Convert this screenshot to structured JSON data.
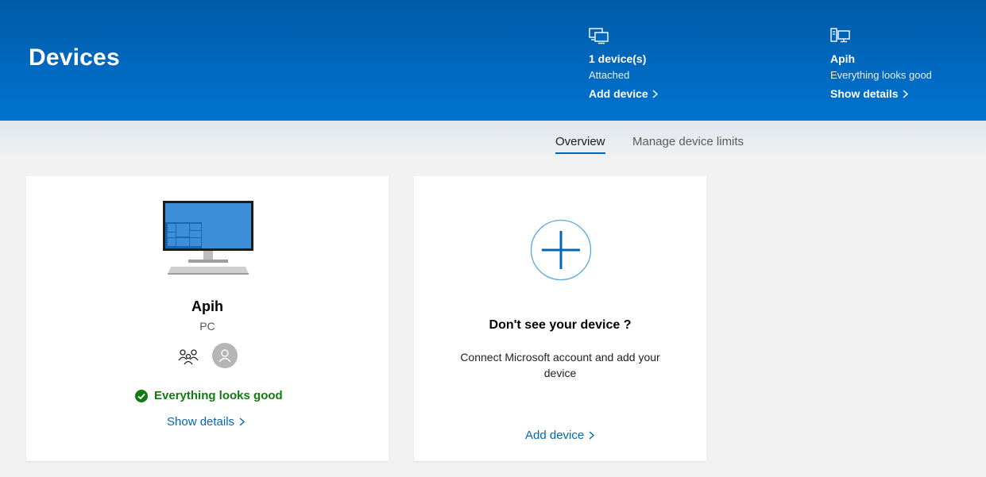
{
  "header": {
    "title": "Devices",
    "stats": {
      "devices": {
        "icon": "devices-icon",
        "headline": "1 device(s)",
        "sub": "Attached",
        "action": "Add device"
      },
      "pc": {
        "icon": "pc-icon",
        "headline": "Apih",
        "sub": "Everything looks good",
        "action": "Show details"
      }
    }
  },
  "tabs": [
    {
      "label": "Overview",
      "active": true
    },
    {
      "label": "Manage device limits",
      "active": false
    }
  ],
  "device_card": {
    "image": "monitor-icon",
    "name": "Apih",
    "type": "PC",
    "family_icon": "family-icon",
    "avatar_icon": "avatar-icon",
    "status": "Everything looks good",
    "status_icon": "check-circle-icon",
    "link": "Show details"
  },
  "add_card": {
    "icon": "plus-circle-icon",
    "title": "Don't see your device ?",
    "description": "Connect Microsoft account and add your device",
    "link": "Add device"
  },
  "colors": {
    "banner": "#0068bf",
    "accent": "#0067b8",
    "success": "#107c10",
    "background": "#f2f2f2"
  }
}
